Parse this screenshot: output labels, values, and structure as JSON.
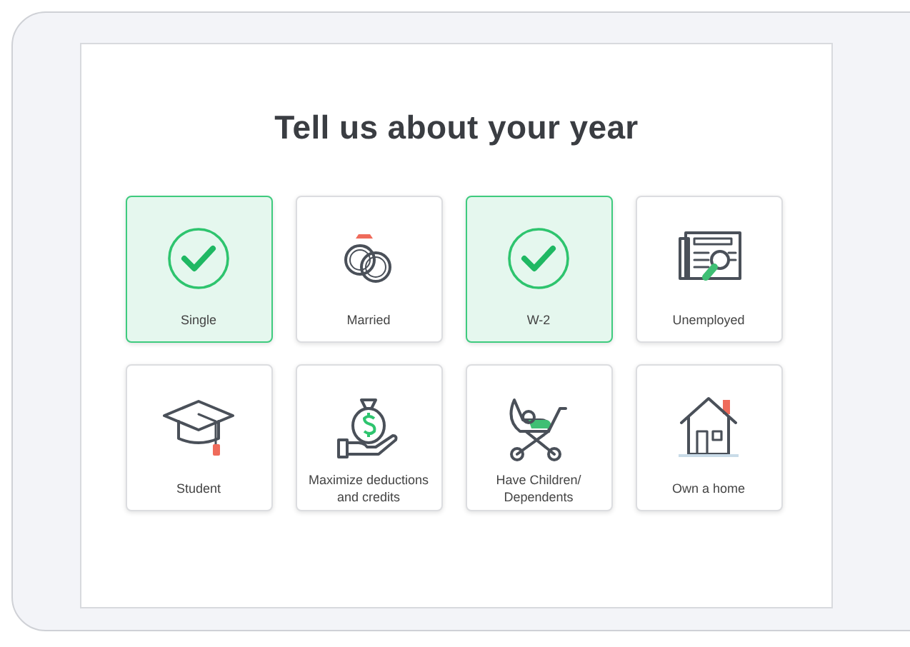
{
  "title": "Tell us about your year",
  "options": [
    {
      "label": "Single",
      "selected": true
    },
    {
      "label": "Married",
      "selected": false
    },
    {
      "label": "W-2",
      "selected": true
    },
    {
      "label": "Unemployed",
      "selected": false
    },
    {
      "label": "Student",
      "selected": false
    },
    {
      "label": "Maximize deductions and credits",
      "selected": false
    },
    {
      "label": "Have Children/ Dependents",
      "selected": false
    },
    {
      "label": "Own a home",
      "selected": false
    }
  ]
}
